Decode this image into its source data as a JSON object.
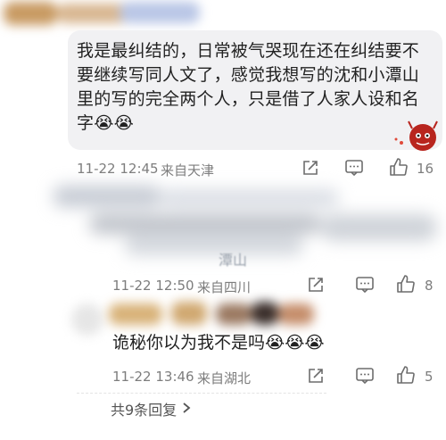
{
  "comment1": {
    "text": "我是最纠结的，日常被气哭现在还在纠结要不要继续写同人文了，感觉我想写的沈和小潭山里的写的完全两个人，只是借了人家人设和名字😭😭",
    "time": "11-22 12:45",
    "location": "来自天津",
    "likes": "16"
  },
  "reply1": {
    "snippet": "潭山",
    "time": "11-22 12:50",
    "location": "来自四川",
    "likes": "8"
  },
  "reply2": {
    "text": "诡秘你以为我不是吗😭😭😭",
    "time": "11-22 13:46",
    "location": "来自湖北",
    "likes": "5"
  },
  "footer": {
    "more_replies": "共9条回复"
  },
  "colors": {
    "meta_gray": "#7d7d7d",
    "bubble_bg": "#f1f1f3"
  },
  "icons": {
    "share": "share-icon",
    "comment": "comment-icon",
    "like": "thumbs-up-icon",
    "chevron": "chevron-right-icon"
  }
}
